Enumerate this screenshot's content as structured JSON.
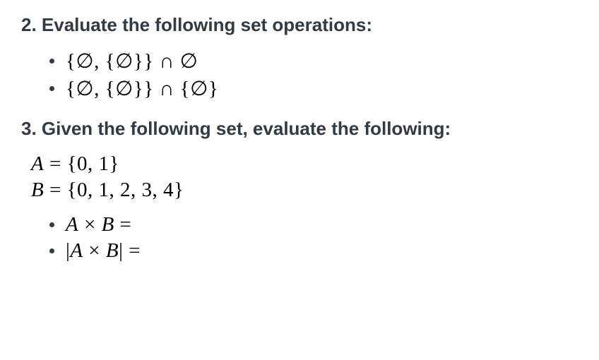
{
  "q2": {
    "heading": "2. Evaluate the following set operations:",
    "items": [
      "{∅, {∅}} ∩ ∅",
      "{∅, {∅}} ∩ {∅}"
    ]
  },
  "q3": {
    "heading": "3. Given the following set, evaluate the following:",
    "setA": "A = {0, 1}",
    "setB": "B = {0, 1, 2, 3, 4}",
    "items": [
      "A × B =",
      "|A × B| ="
    ]
  }
}
